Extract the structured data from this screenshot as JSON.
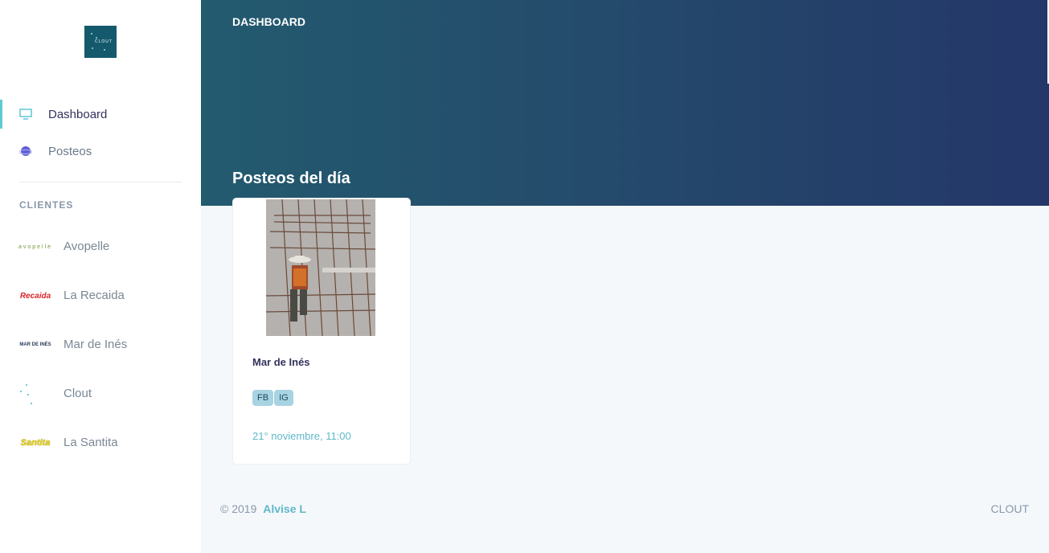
{
  "sidebar": {
    "brand_text": "CLOUT",
    "nav": [
      {
        "label": "Dashboard",
        "icon": "monitor-icon",
        "active": true
      },
      {
        "label": "Posteos",
        "icon": "planet-icon",
        "active": false
      }
    ],
    "section_heading": "CLIENTES",
    "clients": [
      {
        "name": "Avopelle",
        "logo_text": "avopelle"
      },
      {
        "name": "La Recaida",
        "logo_text": "Recaida"
      },
      {
        "name": "Mar de Inés",
        "logo_text": "MAR DE INÉS"
      },
      {
        "name": "Clout",
        "logo_text": ""
      },
      {
        "name": "La Santita",
        "logo_text": "Santita"
      }
    ]
  },
  "header": {
    "breadcrumb": "DASHBOARD",
    "section_title": "Posteos del día"
  },
  "post": {
    "client": "Mar de Inés",
    "networks": [
      "FB",
      "IG"
    ],
    "date": "21° noviembre, 11:00"
  },
  "footer": {
    "copyright": "© 2019",
    "author": "Alvise L",
    "brand": "CLOUT"
  },
  "colors": {
    "accent": "#5fc9d2",
    "header_start": "#235b6f",
    "header_end": "#243769",
    "badge_bg": "#a7d3e2"
  }
}
